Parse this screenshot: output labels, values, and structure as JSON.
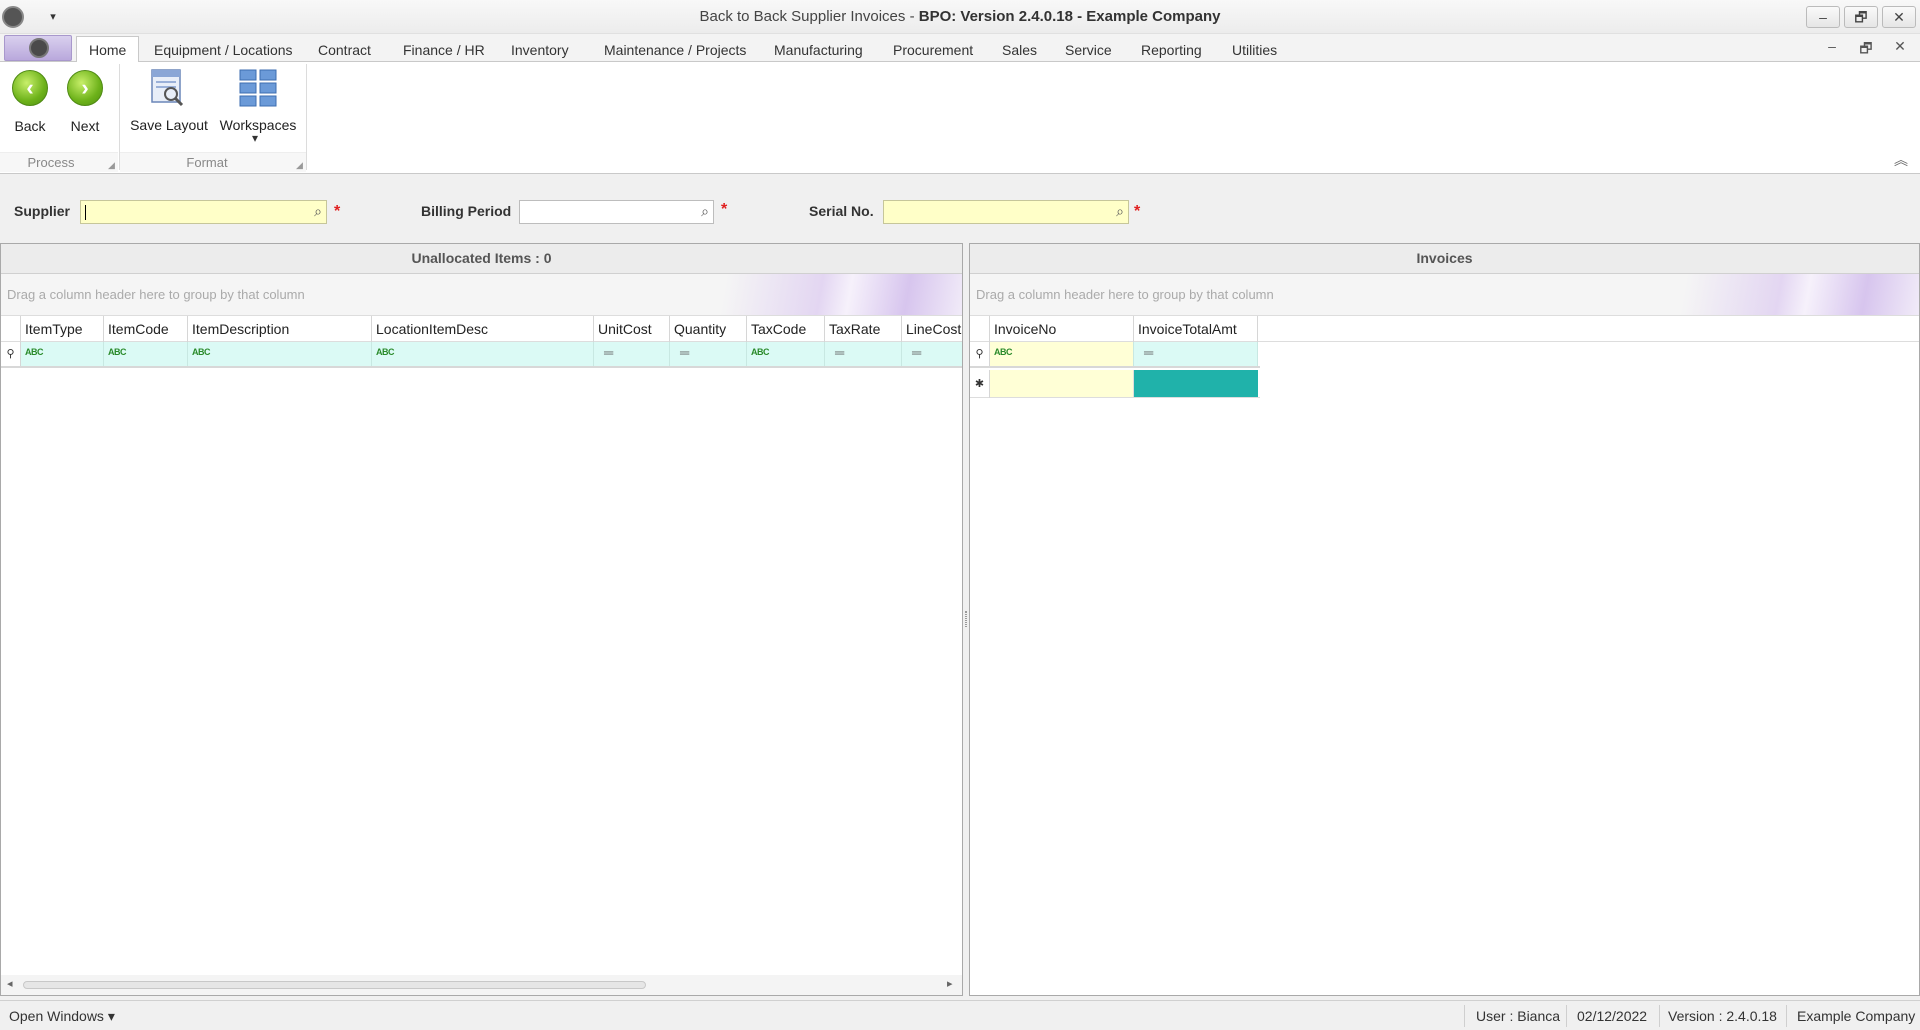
{
  "window": {
    "title_prefix": "Back to Back Supplier Invoices - ",
    "title_bold": "BPO: Version 2.4.0.18 - Example Company",
    "minimize": "–",
    "restore": "🗗",
    "close": "✕"
  },
  "qat": {
    "dropdown": "▾"
  },
  "tabs": [
    {
      "label": "Home",
      "active": true
    },
    {
      "label": "Equipment / Locations"
    },
    {
      "label": "Contract"
    },
    {
      "label": "Finance / HR"
    },
    {
      "label": "Inventory"
    },
    {
      "label": "Maintenance / Projects"
    },
    {
      "label": "Manufacturing"
    },
    {
      "label": "Procurement"
    },
    {
      "label": "Sales"
    },
    {
      "label": "Service"
    },
    {
      "label": "Reporting"
    },
    {
      "label": "Utilities"
    }
  ],
  "mdi": {
    "minimize": "–",
    "restore": "🗗",
    "close": "✕"
  },
  "ribbon": {
    "process": {
      "label": "Process",
      "back": "Back",
      "next": "Next",
      "back_glyph": "‹",
      "next_glyph": "›"
    },
    "format": {
      "label": "Format",
      "save_layout": "Save Layout",
      "workspaces": "Workspaces",
      "workspaces_arrow": "▾"
    },
    "collapse_glyph": "︽",
    "corner_glyph": "◢"
  },
  "filters": {
    "supplier": {
      "label": "Supplier",
      "value": "",
      "required": "*"
    },
    "billing_period": {
      "label": "Billing Period",
      "value": "",
      "required": "*"
    },
    "serial_no": {
      "label": "Serial No.",
      "value": "",
      "required": "*"
    },
    "search_glyph": "⌕"
  },
  "unallocated": {
    "title": "Unallocated Items : 0",
    "group_hint": "Drag a column header here to group by that column",
    "columns": [
      "ItemType",
      "ItemCode",
      "ItemDescription",
      "LocationItemDesc",
      "UnitCost",
      "Quantity",
      "TaxCode",
      "TaxRate",
      "LineCost"
    ],
    "filter_types": [
      "abc",
      "abc",
      "abc",
      "abc",
      "=",
      "=",
      "abc",
      "=",
      "="
    ],
    "filter_glyph": "ABC",
    "eq_glyph": "═",
    "pin_glyph": "⚲",
    "scroll_left": "◂",
    "scroll_right": "▸"
  },
  "invoices": {
    "title": "Invoices",
    "group_hint": "Drag a column header here to group by that column",
    "columns": [
      "InvoiceNo",
      "InvoiceTotalAmt"
    ],
    "filter_types": [
      "abc",
      "="
    ],
    "new_row_glyph": "✱",
    "pin_glyph": "⚲"
  },
  "status": {
    "open_windows": "Open Windows ▾",
    "user": "User : Bianca",
    "date": "02/12/2022",
    "version": "Version : 2.4.0.18",
    "company": "Example Company"
  },
  "colors": {
    "accent_teal": "#20b2aa",
    "required_yellow": "#ffffc8",
    "filter_cyan": "#dbfaf5"
  }
}
